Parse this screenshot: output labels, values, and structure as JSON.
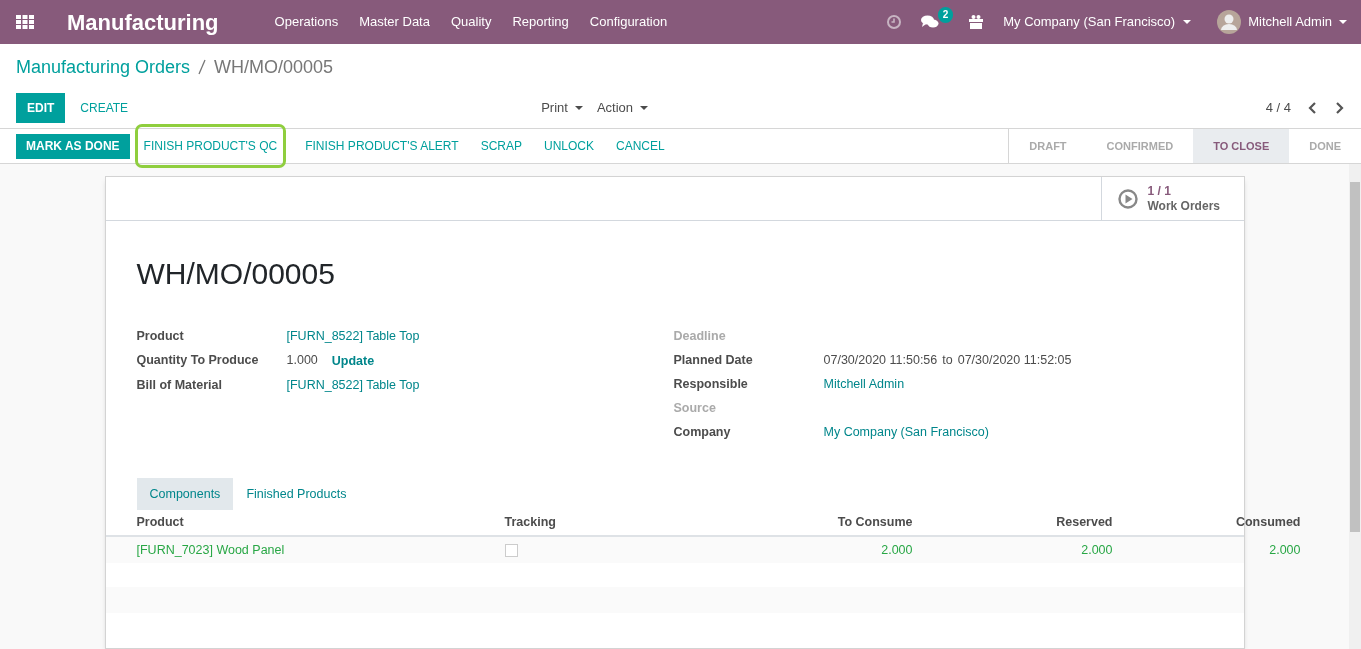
{
  "navbar": {
    "app_name": "Manufacturing",
    "menu": [
      "Operations",
      "Master Data",
      "Quality",
      "Reporting",
      "Configuration"
    ],
    "messages_count": "2",
    "company": "My Company (San Francisco)",
    "user": "Mitchell Admin"
  },
  "breadcrumb": {
    "parent": "Manufacturing Orders",
    "current": "WH/MO/00005"
  },
  "toolbar": {
    "buttons": [
      {
        "label": "EDIT",
        "kind": "primary"
      },
      {
        "label": "CREATE",
        "kind": "link"
      }
    ],
    "dropdowns": [
      "Print",
      "Action"
    ],
    "pager": "4 / 4"
  },
  "header_buttons": [
    {
      "label": "MARK AS DONE",
      "kind": "primary",
      "highlighted": false
    },
    {
      "label": "FINISH PRODUCT'S QC",
      "kind": "link",
      "highlighted": true
    },
    {
      "label": "FINISH PRODUCT'S ALERT",
      "kind": "link",
      "highlighted": false
    },
    {
      "label": "SCRAP",
      "kind": "link",
      "highlighted": false
    },
    {
      "label": "UNLOCK",
      "kind": "link",
      "highlighted": false
    },
    {
      "label": "CANCEL",
      "kind": "link",
      "highlighted": false
    }
  ],
  "stages": [
    {
      "label": "DRAFT",
      "selected": false
    },
    {
      "label": "CONFIRMED",
      "selected": false
    },
    {
      "label": "TO CLOSE",
      "selected": true
    },
    {
      "label": "DONE",
      "selected": false
    }
  ],
  "smart_button": {
    "count": "1 / 1",
    "label": "Work Orders"
  },
  "title": "WH/MO/00005",
  "left_fields": [
    {
      "label": "Product",
      "value": "[FURN_8522] Table Top",
      "kind": "link"
    },
    {
      "label": "Quantity To Produce",
      "value": "1.000",
      "action": "Update",
      "kind": "quantity"
    },
    {
      "label": "Bill of Material",
      "value": "[FURN_8522] Table Top",
      "kind": "link"
    }
  ],
  "right_fields": [
    {
      "label": "Deadline",
      "kind": "empty"
    },
    {
      "label": "Planned Date",
      "value": "07/30/2020 11:50:56",
      "separator": "to",
      "end": "07/30/2020 11:52:05",
      "kind": "range"
    },
    {
      "label": "Responsible",
      "value": "Mitchell Admin",
      "kind": "link"
    },
    {
      "label": "Source",
      "kind": "empty"
    },
    {
      "label": "Company",
      "value": "My Company (San Francisco)",
      "kind": "link"
    }
  ],
  "tabs": [
    {
      "label": "Components",
      "selected": true
    },
    {
      "label": "Finished Products",
      "selected": false
    }
  ],
  "table": {
    "columns": [
      "Product",
      "Tracking",
      "To Consume",
      "Reserved",
      "Consumed"
    ],
    "rows": [
      {
        "product": "[FURN_7023] Wood Panel",
        "tracking": false,
        "to_consume": "2.000",
        "reserved": "2.000",
        "consumed": "2.000"
      }
    ]
  }
}
